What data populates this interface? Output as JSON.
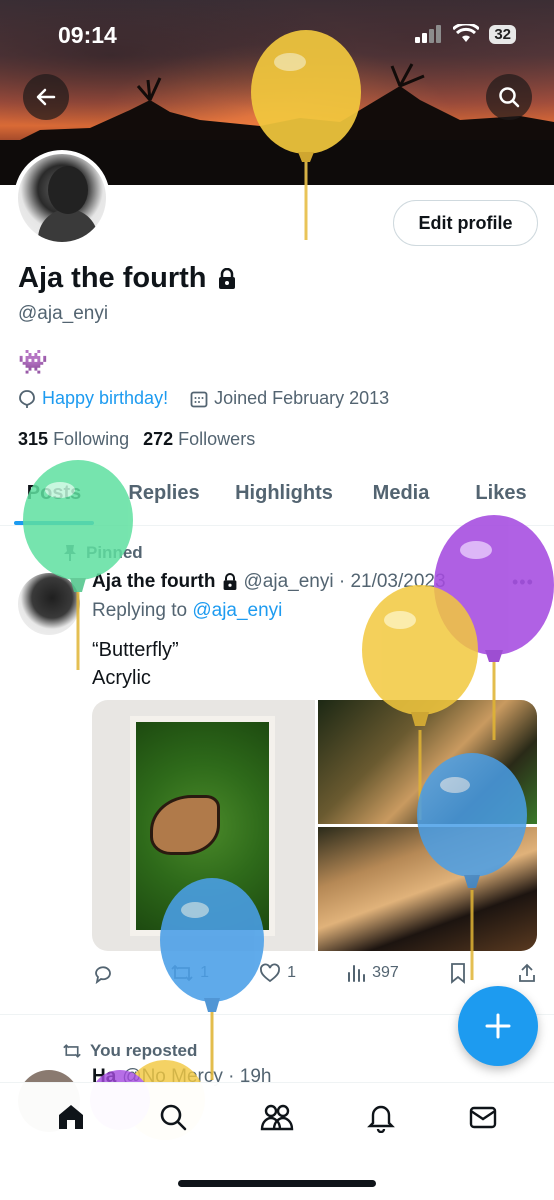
{
  "status_bar": {
    "time": "09:14",
    "battery": "32"
  },
  "profile": {
    "name": "Aja the fourth",
    "handle": "@aja_enyi",
    "bio_emoji": "👾",
    "location": "Happy birthday!",
    "joined": "Joined February 2013",
    "following_count": "315",
    "following_label": "Following",
    "followers_count": "272",
    "followers_label": "Followers",
    "edit_button": "Edit profile"
  },
  "tabs": [
    "Posts",
    "Replies",
    "Highlights",
    "Media",
    "Likes"
  ],
  "active_tab": "Posts",
  "post": {
    "pinned_label": "Pinned",
    "author": "Aja the fourth",
    "handle_date": "@aja_enyi · 21/03/2023",
    "reply_prefix": "Replying to",
    "reply_handle": "@aja_enyi",
    "text_line1": "“Butterfly”",
    "text_line2": "Acrylic",
    "replies": "",
    "reposts": "1",
    "likes": "1",
    "views": "397"
  },
  "next_post": {
    "reposted_label": "You reposted",
    "author_fragment": "Ha",
    "handle_fragment": "@No Mercy · 19h"
  },
  "colors": {
    "accent": "#1d9bf0",
    "text": "#0f1419",
    "muted": "#536471"
  }
}
